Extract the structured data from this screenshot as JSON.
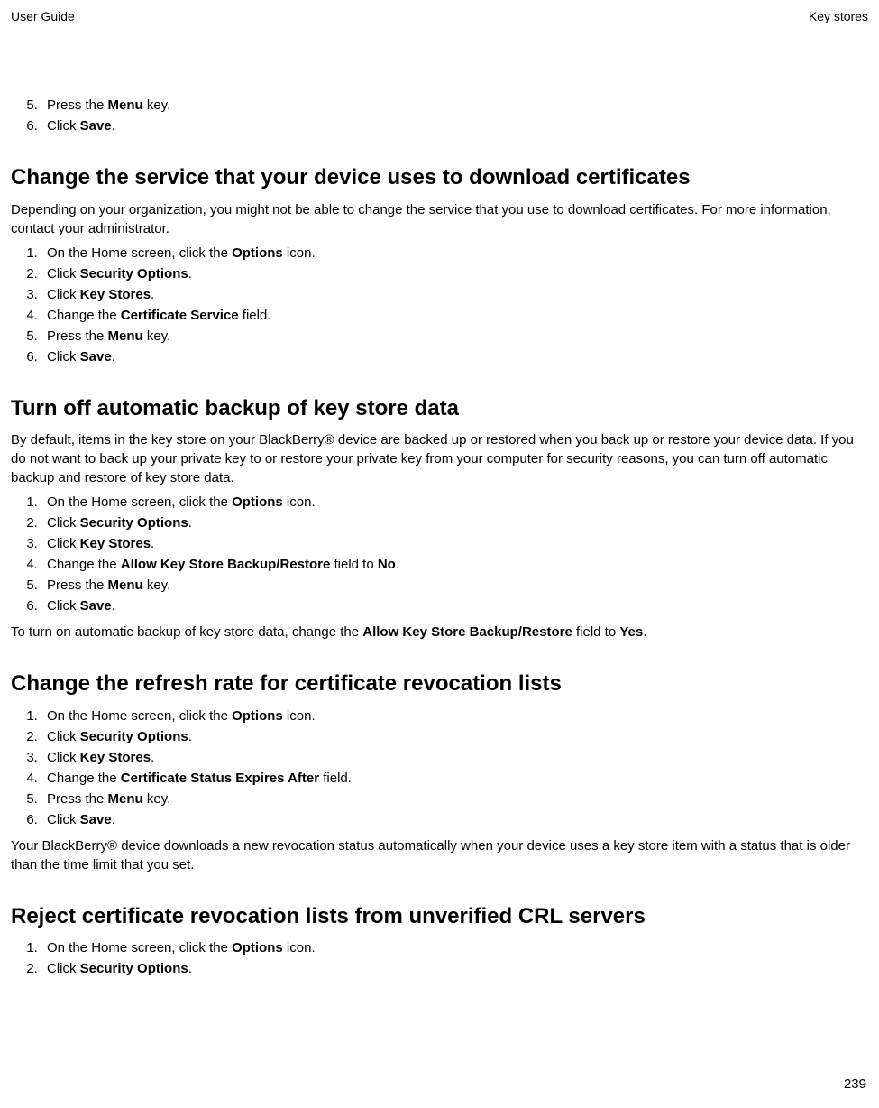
{
  "header": {
    "left": "User Guide",
    "right": "Key stores"
  },
  "pageNumber": "239",
  "intro_list": {
    "start": 5,
    "items": [
      {
        "pre": "Press the ",
        "b": "Menu",
        "post": " key."
      },
      {
        "pre": "Click ",
        "b": "Save",
        "post": "."
      }
    ]
  },
  "sections": [
    {
      "title": "Change the service that your device uses to download certificates",
      "intro": "Depending on your organization, you might not be able to change the service that you use to download certificates. For more information, contact your administrator.",
      "steps": [
        {
          "pre": "On the Home screen, click the ",
          "b": "Options",
          "post": " icon."
        },
        {
          "pre": "Click ",
          "b": "Security Options",
          "post": "."
        },
        {
          "pre": "Click ",
          "b": "Key Stores",
          "post": "."
        },
        {
          "pre": "Change the ",
          "b": "Certificate Service",
          "post": " field."
        },
        {
          "pre": "Press the ",
          "b": "Menu",
          "post": " key."
        },
        {
          "pre": "Click ",
          "b": "Save",
          "post": "."
        }
      ]
    },
    {
      "title": "Turn off automatic backup of key store data",
      "intro": "By default, items in the key store on your BlackBerry® device are backed up or restored when you back up or restore your device data. If you do not want to back up your private key to or restore your private key from your computer for security reasons, you can turn off automatic backup and restore of key store data.",
      "steps": [
        {
          "pre": "On the Home screen, click the ",
          "b": "Options",
          "post": " icon."
        },
        {
          "pre": "Click ",
          "b": "Security Options",
          "post": "."
        },
        {
          "pre": "Click ",
          "b": "Key Stores",
          "post": "."
        },
        {
          "pre": "Change the ",
          "b": "Allow Key Store Backup/Restore",
          "post": " field to ",
          "b2": "No",
          "post2": "."
        },
        {
          "pre": "Press the ",
          "b": "Menu",
          "post": " key."
        },
        {
          "pre": "Click ",
          "b": "Save",
          "post": "."
        }
      ],
      "after": {
        "pre": "To turn on automatic backup of key store data, change the ",
        "b": "Allow Key Store Backup/Restore",
        "mid": " field to ",
        "b2": "Yes",
        "post": "."
      }
    },
    {
      "title": "Change the refresh rate for certificate revocation lists",
      "steps": [
        {
          "pre": "On the Home screen, click the ",
          "b": "Options",
          "post": " icon."
        },
        {
          "pre": "Click ",
          "b": "Security Options",
          "post": "."
        },
        {
          "pre": "Click ",
          "b": "Key Stores",
          "post": "."
        },
        {
          "pre": "Change the ",
          "b": "Certificate Status Expires After",
          "post": " field."
        },
        {
          "pre": "Press the ",
          "b": "Menu",
          "post": " key."
        },
        {
          "pre": "Click ",
          "b": "Save",
          "post": "."
        }
      ],
      "afterPlain": "Your BlackBerry® device downloads a new revocation status automatically when your device uses a key store item with a status that is older than the time limit that you set."
    },
    {
      "title": "Reject certificate revocation lists from unverified CRL servers",
      "steps": [
        {
          "pre": "On the Home screen, click the ",
          "b": "Options",
          "post": " icon."
        },
        {
          "pre": "Click ",
          "b": "Security Options",
          "post": "."
        }
      ]
    }
  ]
}
